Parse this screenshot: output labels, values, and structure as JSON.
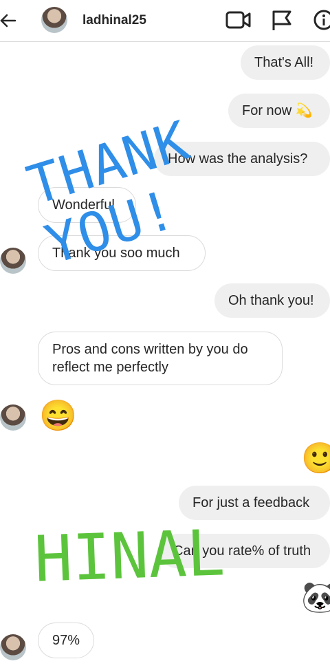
{
  "header": {
    "username": "ladhinal25",
    "icons": [
      "back-arrow-icon",
      "video-call-icon",
      "flag-icon",
      "info-icon"
    ]
  },
  "messages": [
    {
      "side": "out",
      "text": "That's All!"
    },
    {
      "side": "out",
      "text": "For now",
      "emoji": "💫"
    },
    {
      "side": "out",
      "text": "How was the analysis?"
    },
    {
      "side": "in",
      "text": "Wonderful"
    },
    {
      "side": "in",
      "text": "Thank you soo much"
    },
    {
      "side": "out",
      "text": "Oh thank you!"
    },
    {
      "side": "in",
      "text": "Pros and cons written by you do reflect me perfectly"
    },
    {
      "side": "in",
      "emoji": "😄"
    },
    {
      "side": "out",
      "emoji": "🙂"
    },
    {
      "side": "out",
      "text": "For just a feedback"
    },
    {
      "side": "out",
      "text": "Can you rate% of truth"
    },
    {
      "side": "out",
      "emoji": "🐼"
    },
    {
      "side": "in",
      "text": "97%"
    }
  ],
  "overlays": {
    "thank_you": "THANK YOU!",
    "name": "HINAL"
  },
  "colors": {
    "thank_you_text": "#2f8ee8",
    "name_text": "#5cc43c",
    "outgoing_bubble": "#efefef",
    "incoming_border": "#dbdbdb"
  }
}
